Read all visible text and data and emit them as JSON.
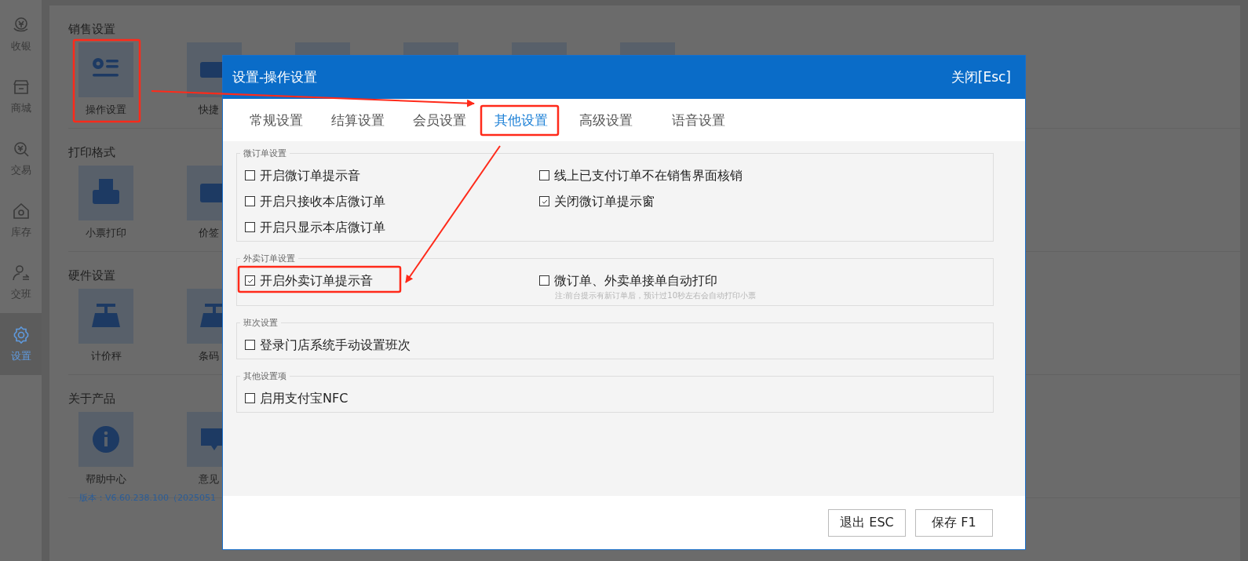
{
  "sidebar": {
    "items": [
      {
        "label": "收银",
        "selected": false
      },
      {
        "label": "商城",
        "selected": false
      },
      {
        "label": "交易",
        "selected": false
      },
      {
        "label": "库存",
        "selected": false
      },
      {
        "label": "交班",
        "selected": false
      },
      {
        "label": "设置",
        "selected": true
      }
    ]
  },
  "sections": [
    {
      "title": "销售设置",
      "tiles": [
        {
          "label": "操作设置"
        },
        {
          "label": "快捷"
        }
      ]
    },
    {
      "title": "打印格式",
      "tiles": [
        {
          "label": "小票打印"
        },
        {
          "label": "价签"
        }
      ]
    },
    {
      "title": "硬件设置",
      "tiles": [
        {
          "label": "计价秤"
        },
        {
          "label": "条码"
        }
      ]
    },
    {
      "title": "关于产品",
      "tiles": [
        {
          "label": "帮助中心"
        },
        {
          "label": "意见"
        }
      ]
    }
  ],
  "version": "版本：V6.60.238.100（2025051",
  "dialog": {
    "title": "设置-操作设置",
    "close": "关闭[Esc]",
    "tabs": [
      {
        "label": "常规设置",
        "selected": false
      },
      {
        "label": "结算设置",
        "selected": false
      },
      {
        "label": "会员设置",
        "selected": false
      },
      {
        "label": "其他设置",
        "selected": true
      },
      {
        "label": "高级设置",
        "selected": false
      },
      {
        "label": "语音设置",
        "selected": false
      }
    ],
    "groups": [
      {
        "title": "微订单设置",
        "options": [
          {
            "label": "开启微订单提示音",
            "checked": false
          },
          {
            "label": "线上已支付订单不在销售界面核销",
            "checked": false
          },
          {
            "label": "开启只接收本店微订单",
            "checked": false
          },
          {
            "label": "关闭微订单提示窗",
            "checked": true
          },
          {
            "label": "开启只显示本店微订单",
            "checked": false
          }
        ]
      },
      {
        "title": "外卖订单设置",
        "options": [
          {
            "label": "开启外卖订单提示音",
            "checked": true
          },
          {
            "label": "微订单、外卖单接单自动打印",
            "checked": false,
            "note": "注:前台提示有新订单后，预计过10秒左右会自动打印小票"
          }
        ]
      },
      {
        "title": "班次设置",
        "options": [
          {
            "label": "登录门店系统手动设置班次",
            "checked": false
          }
        ]
      },
      {
        "title": "其他设置项",
        "options": [
          {
            "label": "启用支付宝NFC",
            "checked": false
          }
        ]
      }
    ],
    "buttons": [
      "退出 ESC",
      "保存 F1"
    ]
  }
}
